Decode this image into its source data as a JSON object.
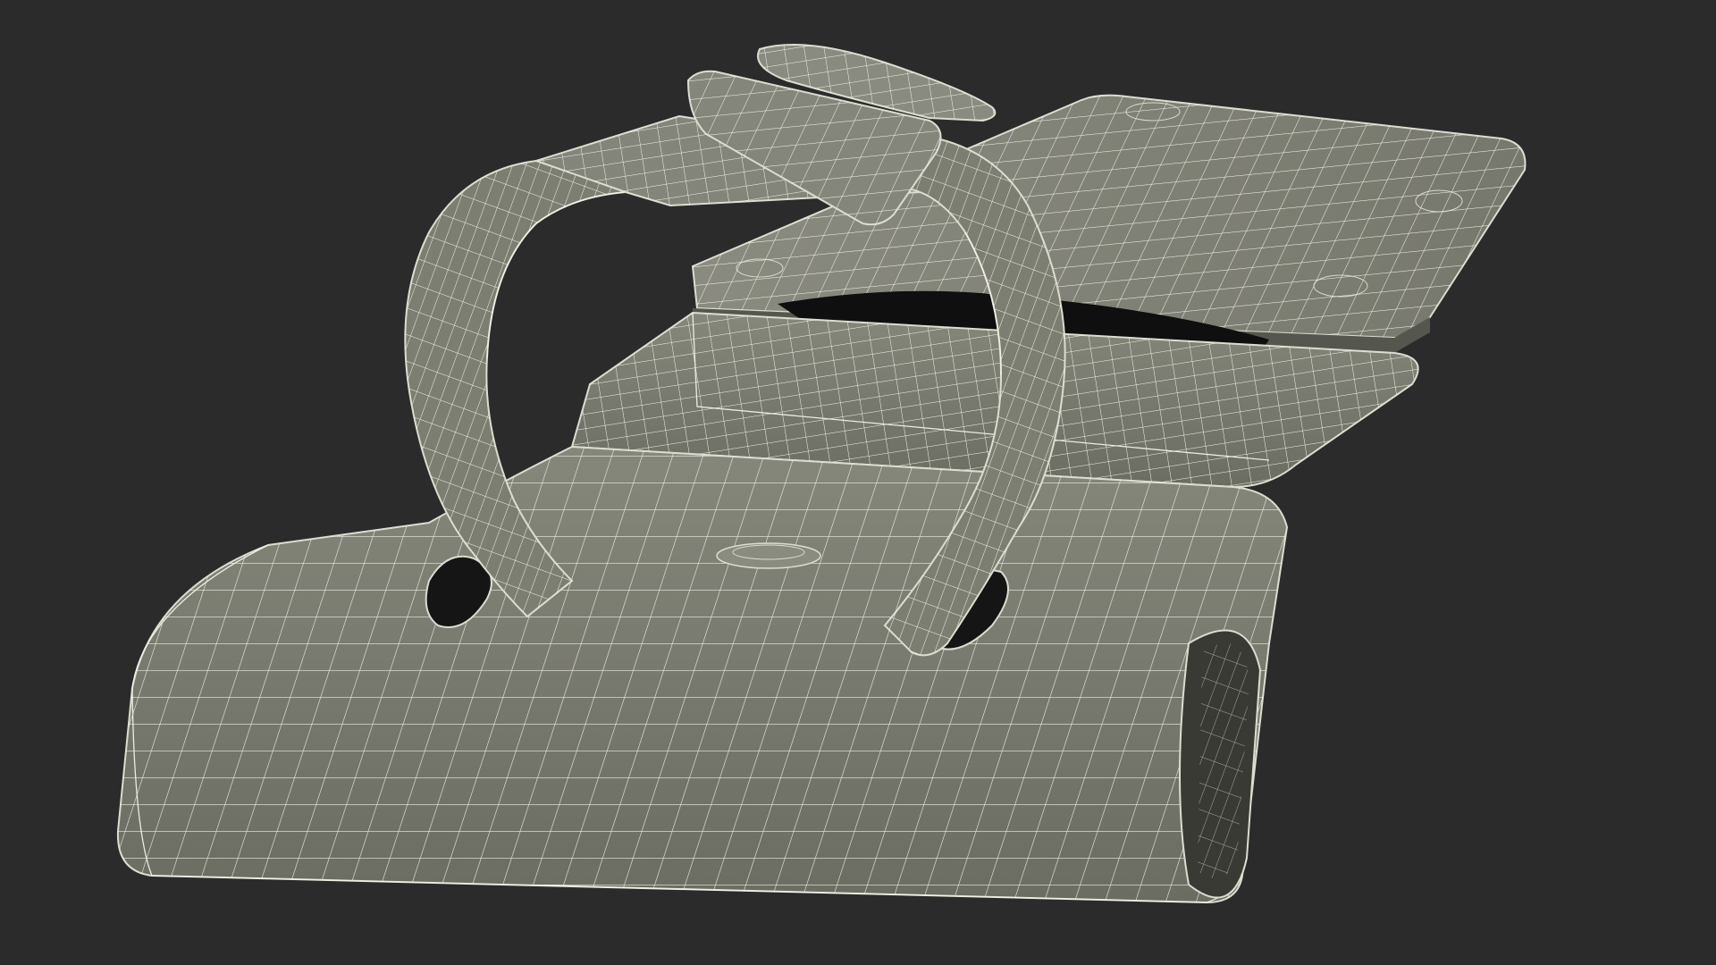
{
  "viewport": {
    "background": "#2b2b2b"
  },
  "model": {
    "subject": "wireframe-hasp-strap-clip",
    "shading": "wireframe-on-shaded",
    "surface_color": "#7b7c70",
    "wire_color": "#f2f2e8",
    "shadow_color": "#0d0d0d"
  }
}
